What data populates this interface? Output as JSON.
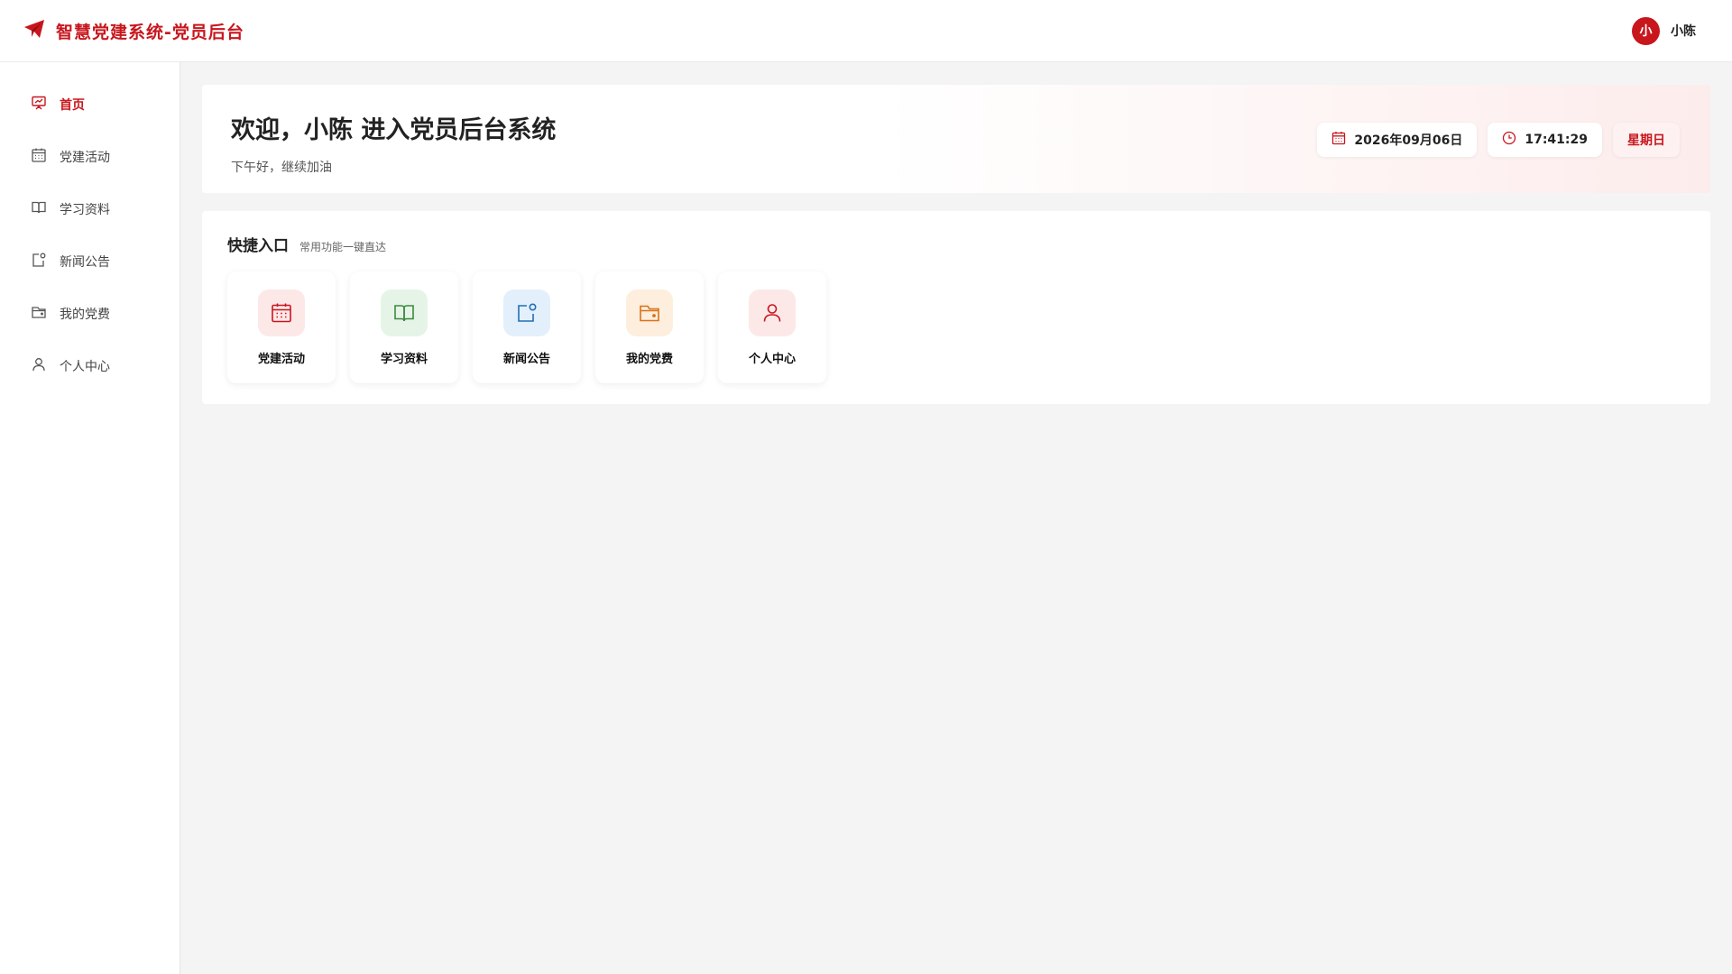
{
  "header": {
    "title": "智慧党建系统-党员后台",
    "logo_icon": "paper-plane-icon",
    "user": {
      "avatar_text": "小",
      "name": "小陈"
    }
  },
  "colors": {
    "accent": "#c8161d"
  },
  "sidebar": {
    "items": [
      {
        "label": "首页",
        "icon": "presentation-chart-icon",
        "active": true
      },
      {
        "label": "党建活动",
        "icon": "calendar-icon"
      },
      {
        "label": "学习资料",
        "icon": "book-open-icon"
      },
      {
        "label": "新闻公告",
        "icon": "notification-icon"
      },
      {
        "label": "我的党费",
        "icon": "wallet-icon"
      },
      {
        "label": "个人中心",
        "icon": "user-icon"
      }
    ]
  },
  "welcome": {
    "title": "欢迎，小陈 进入党员后台系统",
    "subtitle": "下午好，继续加油",
    "date": "2026年09月06日",
    "time": "17:41:29",
    "weekday": "星期日"
  },
  "quick": {
    "title": "快捷入口",
    "subtitle": "常用功能一键直达",
    "cards": [
      {
        "label": "党建活动",
        "icon": "calendar-icon",
        "bg": "#fde8e8",
        "fg": "#c8161d"
      },
      {
        "label": "学习资料",
        "icon": "book-open-icon",
        "bg": "#e6f4e8",
        "fg": "#3a8a3f"
      },
      {
        "label": "新闻公告",
        "icon": "notification-icon",
        "bg": "#e3f0fb",
        "fg": "#1f6fb5"
      },
      {
        "label": "我的党费",
        "icon": "wallet-icon",
        "bg": "#fdeedd",
        "fg": "#d9731a"
      },
      {
        "label": "个人中心",
        "icon": "user-icon",
        "bg": "#fde8e8",
        "fg": "#c8161d"
      }
    ]
  }
}
